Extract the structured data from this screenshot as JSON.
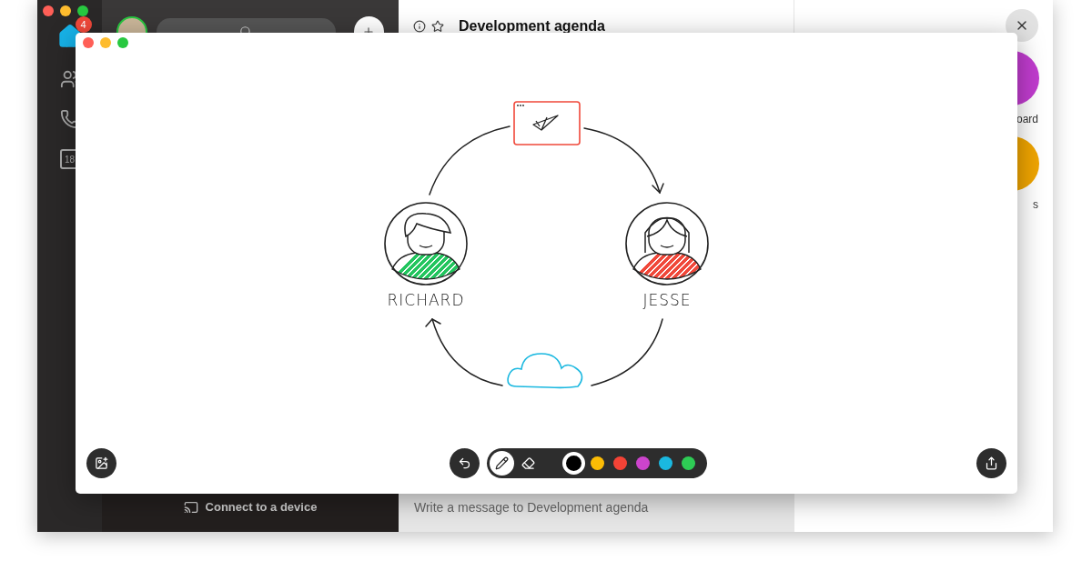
{
  "background_app": {
    "sidebar": {
      "badge": "4",
      "calendar_day": "18"
    },
    "spaces_panel": {
      "device_link": "Connect to a device"
    },
    "conversation": {
      "title": "Development agenda",
      "message_placeholder": "Write a message to Development agenda"
    },
    "side_actions": [
      {
        "label": "oard",
        "color": "#c13ccf"
      },
      {
        "label": "s",
        "color": "#f0a500"
      }
    ]
  },
  "whiteboard": {
    "people": [
      {
        "name": "RICHARD",
        "color": "#22c55e"
      },
      {
        "name": "JESSE",
        "color": "#f0483a"
      }
    ],
    "tools": [
      {
        "kind": "pen",
        "selected": true
      },
      {
        "kind": "eraser",
        "selected": false
      }
    ],
    "colors": [
      {
        "color": "#000000",
        "selected": true
      },
      {
        "color": "#fbbc05",
        "selected": false
      },
      {
        "color": "#f44336",
        "selected": false
      },
      {
        "color": "#cc44cc",
        "selected": false
      },
      {
        "color": "#1ab8e0",
        "selected": false
      },
      {
        "color": "#2ecc55",
        "selected": false
      }
    ]
  }
}
